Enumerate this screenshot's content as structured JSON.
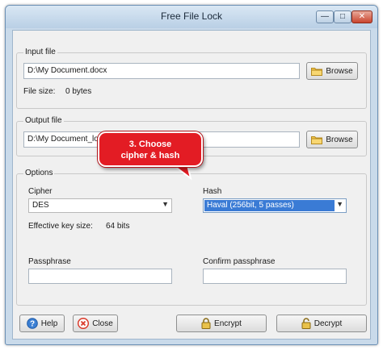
{
  "window": {
    "title": "Free File Lock"
  },
  "titlebar_buttons": {
    "minimize": "—",
    "maximize": "□",
    "close": "✕"
  },
  "input": {
    "legend": "Input file",
    "path": "D:\\My Document.docx",
    "browse_label": "Browse",
    "file_size_label": "File size:",
    "file_size_value": "0 bytes"
  },
  "output": {
    "legend": "Output file",
    "path": "D:\\My Document_lock",
    "browse_label": "Browse"
  },
  "callout": {
    "line1": "3. Choose",
    "line2": "cipher & hash"
  },
  "options": {
    "legend": "Options",
    "cipher_label": "Cipher",
    "cipher_value": "DES",
    "hash_label": "Hash",
    "hash_value": "Haval (256bit, 5 passes)",
    "key_size_label": "Effective key size:",
    "key_size_value": "64 bits",
    "passphrase_label": "Passphrase",
    "passphrase_value": "",
    "confirm_label": "Confirm passphrase",
    "confirm_value": ""
  },
  "buttons": {
    "help": "Help",
    "close": "Close",
    "encrypt": "Encrypt",
    "decrypt": "Decrypt"
  },
  "colors": {
    "callout": "#e31c24",
    "selection": "#3a7bd5",
    "help_icon": "#3b7fd3",
    "close_icon": "#d93a2b"
  }
}
